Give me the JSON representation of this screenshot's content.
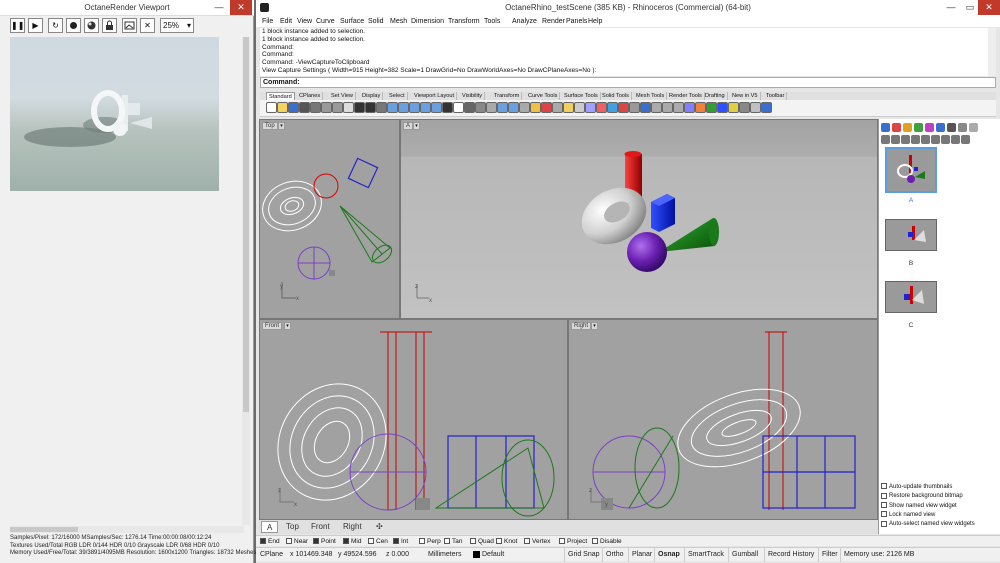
{
  "octane": {
    "title": "OctaneRender Viewport",
    "min_glyph": "—",
    "close_glyph": "✕",
    "toolbar": {
      "pause_glyph": "❚❚",
      "play_glyph": "▶",
      "reset_glyph": "↻",
      "zoom": "25%",
      "zoom_arrow": "▾",
      "close_glyph": "✕"
    },
    "stats": [
      "Samples/Pixel: 172/16000  MSamples/Sec: 1276.14  Time:00:00:08/00:12:24",
      "Textures Used/Total RGB LDR 0/144  HDR 0/10  Grayscale LDR 0/68  HDR 0/10",
      "Memory Used/Free/Total: 39/3891/4095MB  Resolution: 1600x1200  Triangles: 18732  Meshes:"
    ]
  },
  "rhino": {
    "title": "OctaneRhino_testScene (385 KB) - Rhinoceros (Commercial) (64-bit)",
    "min_glyph": "—",
    "max_glyph": "▭",
    "close_glyph": "✕",
    "menu": [
      "File",
      "Edit",
      "View",
      "Curve",
      "Surface",
      "Solid",
      "Mesh",
      "Dimension",
      "Transform",
      "Tools",
      "Analyze",
      "Render",
      "Panels",
      "Help"
    ],
    "command_history": [
      "1 block instance added to selection.",
      "1 block instance added to selection.",
      "Command:",
      "Command:",
      "Command: -ViewCaptureToClipboard",
      "View Capture Settings ( Width=915  Height=382  Scale=1  DrawGrid=No  DrawWorldAxes=No  DrawCPlaneAxes=No ):"
    ],
    "command_prompt": "Command:",
    "toolbar_tabs": [
      "Standard",
      "CPlanes",
      "Set View",
      "Display",
      "Select",
      "Viewport Layout",
      "Visibility",
      "Transform",
      "Curve Tools",
      "Surface Tools",
      "Solid Tools",
      "Mesh Tools",
      "Render Tools",
      "Drafting",
      "New in V5",
      "Toolbar"
    ],
    "viewports": {
      "top": "Top",
      "persp": "A",
      "front": "Front",
      "right": "Right",
      "menu_arrow": "▾"
    },
    "axis_labels": {
      "x": "x",
      "y": "y",
      "z": "z"
    },
    "viewport_tabs": [
      "A",
      "Top",
      "Front",
      "Right",
      "✣"
    ],
    "named_views": [
      "A",
      "B",
      "C"
    ],
    "panel_options": [
      {
        "label": "Auto-update thumbnails",
        "checked": false
      },
      {
        "label": "Restore background bitmap",
        "checked": false
      },
      {
        "label": "Show named view widget",
        "checked": false
      },
      {
        "label": "Lock named view",
        "checked": false
      },
      {
        "label": "Auto-select named view widgets",
        "checked": false
      }
    ],
    "osnaps": [
      {
        "label": "End",
        "checked": true
      },
      {
        "label": "Near",
        "checked": false
      },
      {
        "label": "Point",
        "checked": true
      },
      {
        "label": "Mid",
        "checked": true
      },
      {
        "label": "Cen",
        "checked": false
      },
      {
        "label": "Int",
        "checked": true
      },
      {
        "label": "Perp",
        "checked": false
      },
      {
        "label": "Tan",
        "checked": false
      },
      {
        "label": "Quad",
        "checked": false
      },
      {
        "label": "Knot",
        "checked": false
      },
      {
        "label": "Vertex",
        "checked": false
      },
      {
        "label": "Project",
        "checked": false
      },
      {
        "label": "Disable",
        "checked": false
      }
    ],
    "status": {
      "cplane": "CPlane",
      "x": "x 101469.348",
      "y": "y 49524.596",
      "z": "z 0.000",
      "units": "Millimeters",
      "layer": "Default",
      "grid_snap": "Grid Snap",
      "ortho": "Ortho",
      "planar": "Planar",
      "osnap": "Osnap",
      "smarttrack": "SmartTrack",
      "gumball": "Gumball",
      "record_history": "Record History",
      "filter": "Filter",
      "memory": "Memory use: 2126 MB"
    }
  },
  "colors": {
    "red_object": "#c20000",
    "blue_object": "#1a2fd8",
    "green_object": "#1d7a1d",
    "purple_object": "#6a1fb0",
    "wire_white": "#ffffff",
    "viewport_bg": "#a1a1a1"
  }
}
